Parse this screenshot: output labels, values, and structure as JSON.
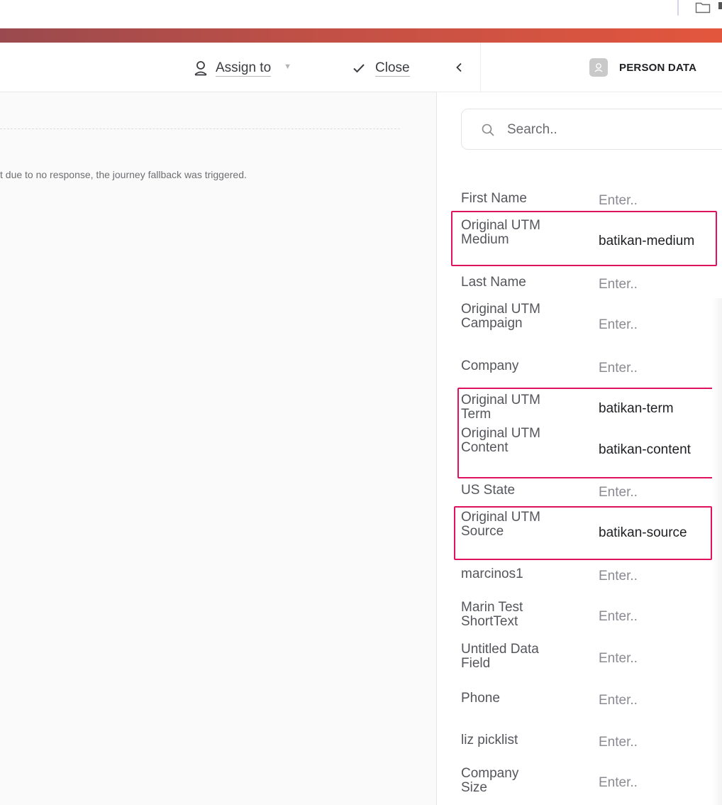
{
  "toolbar": {
    "assign_label": "Assign to",
    "close_label": "Close"
  },
  "conversation": {
    "message": "t due to no response, the journey fallback was triggered."
  },
  "panel": {
    "title": "PERSON DATA",
    "search_placeholder": "Search.."
  },
  "fields": [
    {
      "label": "First Name",
      "value": "Enter.."
    },
    {
      "label": "Original UTM Medium",
      "value": "batikan-medium"
    },
    {
      "label": "Last Name",
      "value": "Enter.."
    },
    {
      "label": "Original UTM Campaign",
      "value": "Enter.."
    },
    {
      "label": "Company",
      "value": "Enter.."
    },
    {
      "label": "Original UTM Term",
      "value": "batikan-term"
    },
    {
      "label": "Original UTM Content",
      "value": "batikan-content"
    },
    {
      "label": "US State",
      "value": "Enter.."
    },
    {
      "label": "Original UTM Source",
      "value": "batikan-source"
    },
    {
      "label": "marcinos1",
      "value": "Enter.."
    },
    {
      "label": "Marin Test ShortText",
      "value": "Enter.."
    },
    {
      "label": "Untitled Data Field",
      "value": "Enter.."
    },
    {
      "label": "Phone",
      "value": "Enter.."
    },
    {
      "label": "liz picklist",
      "value": "Enter.."
    },
    {
      "label": "Company Size",
      "value": "Enter.."
    }
  ],
  "colors": {
    "accent_start": "#9a4a4e",
    "accent_end": "#e2563d",
    "highlight": "#e0115f"
  },
  "icons": [
    "folder-icon",
    "user-icon",
    "check-icon",
    "chevron-left-icon",
    "person-avatar-icon",
    "search-icon",
    "caret-down-icon"
  ]
}
